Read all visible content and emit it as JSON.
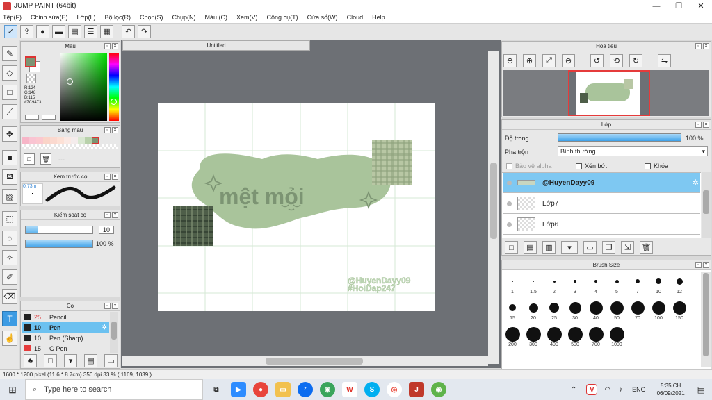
{
  "window": {
    "title": "JUMP PAINT (64bit)",
    "minimize": "—",
    "restore": "❐",
    "close": "✕"
  },
  "menu": [
    "Tệp(F)",
    "Chỉnh sửa(E)",
    "Lớp(L)",
    "Bộ lọc(R)",
    "Chọn(S)",
    "Chụp(N)",
    "Màu (C)",
    "Xem(V)",
    "Công cụ(T)",
    "Cửa sổ(W)",
    "Cloud",
    "Help"
  ],
  "color_panel": {
    "title": "Màu",
    "r": "R:124",
    "g": "G:148",
    "b": "B:115",
    "hex": "#7C9473",
    "main_color": "#7c9473"
  },
  "swatch_panel": {
    "title": "Bảng màu",
    "dash": "---"
  },
  "brush_preview": {
    "title": "Xem trước cọ",
    "size": "0.73m"
  },
  "brush_control": {
    "title": "Kiểm soát cọ",
    "size_value": "10",
    "opacity_value": "100 %"
  },
  "brush_list": {
    "title": "Cọ",
    "items": [
      {
        "size": "25",
        "name": "Pencil",
        "color": "#222222"
      },
      {
        "size": "10",
        "name": "Pen",
        "color": "#222222"
      },
      {
        "size": "10",
        "name": "Pen (Sharp)",
        "color": "#222222"
      },
      {
        "size": "15",
        "name": "G Pen",
        "color": "#e53b3b"
      }
    ]
  },
  "document": {
    "tab": "Untitled"
  },
  "artwork": {
    "title_text": "mệt mỏi",
    "credit_1": "@HuyenDayy09",
    "credit_2": "#HoiDap247",
    "blob_color": "#a9c49b",
    "text_color": "#7c9473"
  },
  "navigator": {
    "title": "Hoa tiêu"
  },
  "layer_panel": {
    "title": "Lớp",
    "opacity_label": "Độ trong",
    "opacity_value": "100 %",
    "blend_label": "Pha trộn",
    "blend_value": "Bình thường",
    "protect_alpha": "Bảo vệ alpha",
    "clipping": "Xén bớt",
    "lock": "Khóa",
    "layers": [
      "@HuyenDayy09",
      "Lớp7",
      "Lớp6"
    ]
  },
  "brush_size": {
    "title": "Brush Size",
    "sizes": [
      "1",
      "1.5",
      "2",
      "3",
      "4",
      "5",
      "7",
      "10",
      "12",
      "15",
      "20",
      "25",
      "30",
      "40",
      "50",
      "70",
      "100",
      "150",
      "200",
      "300",
      "400",
      "500",
      "700",
      "1000"
    ]
  },
  "status": {
    "text": "1600 * 1200 pixel   (11.6 * 8.7cm)   350 dpi   33 %   ( 1169, 1039 )"
  },
  "taskbar": {
    "search_placeholder": "Type here to search",
    "lang": "ENG",
    "time": "5:35 CH",
    "date": "06/09/2021"
  }
}
